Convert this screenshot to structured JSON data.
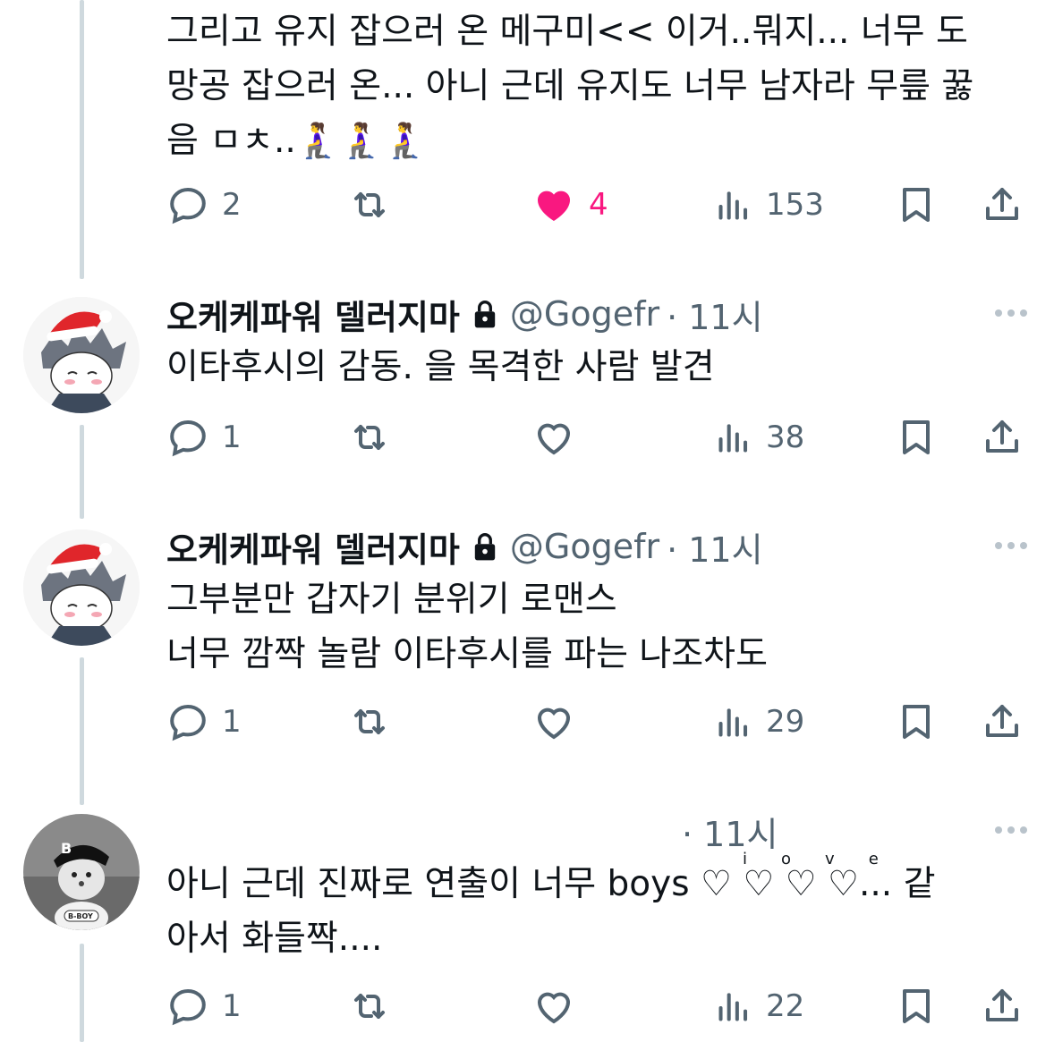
{
  "colors": {
    "text": "#0f1419",
    "muted": "#536471",
    "like": "#f91880",
    "thread": "#cfd9de"
  },
  "tweets": [
    {
      "body": "그리고 유지 잡으러 온 메구미<< 이거..뭐지... 너무 도\n망공 잡으러 온... 아니 근데 유지도 너무 남자라 무릎 꿇\n음 ㅁㅊ..🧎‍♀️🧎‍♀️🧎‍♀️",
      "replies": "2",
      "retweets": "",
      "likes": "4",
      "liked": true,
      "views": "153"
    },
    {
      "name": "오케케파워 델러지마",
      "handle": "@Gogefr",
      "time": "· 11시",
      "avatar": "santa-hat-character-avatar",
      "body": "이타후시의 감동. 을 목격한 사람 발견",
      "replies": "1",
      "retweets": "",
      "likes": "",
      "liked": false,
      "views": "38"
    },
    {
      "name": "오케케파워 델러지마",
      "handle": "@Gogefr",
      "time": "· 11시",
      "avatar": "santa-hat-character-avatar",
      "body": "그부분만 갑자기 분위기 로맨스\n너무 깜짝 놀람 이타후시를 파는 나조차도",
      "replies": "1",
      "retweets": "",
      "likes": "",
      "liked": false,
      "views": "29"
    },
    {
      "name": "",
      "handle": "",
      "time": "· 11시",
      "avatar": "b-boy-avatar",
      "body": "아니 근데 진짜로 연출이 너무 boys ♡ ♡ ♡ ♡... 같\n아서 화들짝....",
      "heart_letters": [
        "i",
        "o",
        "v",
        "e"
      ],
      "replies": "1",
      "retweets": "",
      "likes": "",
      "liked": false,
      "views": "22"
    }
  ]
}
